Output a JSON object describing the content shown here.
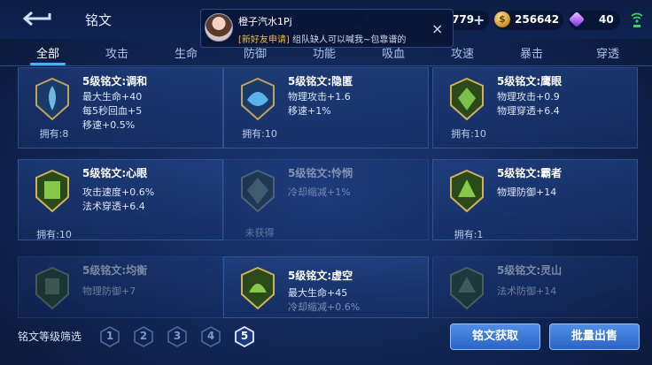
{
  "header": {
    "title": "铭文",
    "back_icon": "back-arrow-icon",
    "resources": {
      "currency1": "779",
      "coins": "256642",
      "gems": "40"
    }
  },
  "notification": {
    "name": "橙子汽水1Pj",
    "tag": "[新好友申请]",
    "message": "组队缺人可以喊我~包靠谱的",
    "close": "×"
  },
  "tabs": [
    "全部",
    "攻击",
    "生命",
    "防御",
    "功能",
    "吸血",
    "攻速",
    "暴击",
    "穿透"
  ],
  "active_tab": "全部",
  "cards": [
    {
      "name": "5级铭文:调和",
      "stats": [
        "最大生命+40",
        "每5秒回血+5",
        "移速+0.5%"
      ],
      "owned": "拥有:8",
      "color": "#6fb8e6"
    },
    {
      "name": "5级铭文:隐匿",
      "stats": [
        "物理攻击+1.6",
        "移速+1%"
      ],
      "owned": "拥有:10",
      "color": "#5ab3ea"
    },
    {
      "name": "5级铭文:鹰眼",
      "stats": [
        "物理攻击+0.9",
        "物理穿透+6.4"
      ],
      "owned": "拥有:10",
      "color": "#7cc04a"
    },
    {
      "name": "5级铭文:心眼",
      "stats": [
        "攻击速度+0.6%",
        "法术穿透+6.4"
      ],
      "owned": "拥有:10",
      "color": "#86c84a"
    },
    {
      "name": "5级铭文:怜悯",
      "stats": [
        "冷却缩减+1%"
      ],
      "owned": "未获得",
      "color": "#6e8a74"
    },
    {
      "name": "5级铭文:霸者",
      "stats": [
        "物理防御+14"
      ],
      "owned": "拥有:1",
      "color": "#86c84a"
    },
    {
      "name": "5级铭文:均衡",
      "stats": [
        "物理防御+7"
      ],
      "owned": "",
      "color": "#6e9a54"
    },
    {
      "name": "5级铭文:虚空",
      "stats": [
        "最大生命+45",
        "冷却缩减+0.6%"
      ],
      "owned": "",
      "color": "#86c84a"
    },
    {
      "name": "5级铭文:灵山",
      "stats": [
        "法术防御+14"
      ],
      "owned": "",
      "color": "#6e9a54"
    }
  ],
  "footer": {
    "filter_label": "铭文等级筛选",
    "levels": [
      "1",
      "2",
      "3",
      "4",
      "5"
    ],
    "active_level": "5",
    "btn_acquire": "铭文获取",
    "btn_sell": "批量出售"
  },
  "colors": {
    "accent": "#48b4ff",
    "button": "#2b63c6",
    "background": "#13295a"
  }
}
